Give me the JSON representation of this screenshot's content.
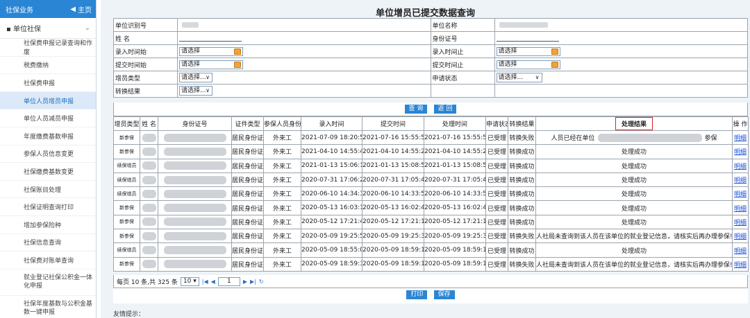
{
  "sidebar": {
    "header": "社保业务",
    "home": "主页",
    "group": "单位社保",
    "items": [
      {
        "label": "社保费申报记录查询和作废",
        "active": false
      },
      {
        "label": "税费缴纳",
        "active": false
      },
      {
        "label": "社保费申报",
        "active": false
      },
      {
        "label": "单位人员增员申报",
        "active": true
      },
      {
        "label": "单位人员减员申报",
        "active": false
      },
      {
        "label": "年度缴费基数申报",
        "active": false
      },
      {
        "label": "参保人员信息变更",
        "active": false
      },
      {
        "label": "社保缴费基数变更",
        "active": false
      },
      {
        "label": "社保账目处理",
        "active": false
      },
      {
        "label": "社保证明查询打印",
        "active": false
      },
      {
        "label": "增加参保险种",
        "active": false
      },
      {
        "label": "社保信息查询",
        "active": false
      },
      {
        "label": "社保费对账单查询",
        "active": false
      },
      {
        "label": "就业登记社保公积金一体化申报",
        "active": false
      },
      {
        "label": "社保年度基数与公积金基数一键申报",
        "active": false
      }
    ]
  },
  "page": {
    "title": "单位增员已提交数据查询"
  },
  "form": {
    "unit_id_label": "单位识别号",
    "unit_name_label": "单位名称",
    "name_label": "姓 名",
    "id_label": "身份证号",
    "entry_start_label": "录入时间始",
    "entry_end_label": "录入时间止",
    "submit_start_label": "提交时间始",
    "submit_end_label": "提交时间止",
    "type_label": "增员类型",
    "status_label": "申请状态",
    "result_label": "转换结果",
    "date_placeholder": "请选择",
    "select_placeholder": "请选择..."
  },
  "buttons": {
    "query": "查 询",
    "back": "返 回",
    "print": "打印",
    "save": "保存"
  },
  "table": {
    "headers": [
      "增员类型",
      "姓 名",
      "身份证号",
      "证件类型",
      "参保人员身份",
      "录入时间",
      "提交时间",
      "处理时间",
      "申请状态",
      "转换结果",
      "处理结果",
      "操 作"
    ],
    "rows": [
      {
        "type": "新参保",
        "idtype": "居民身份证",
        "identity": "外来工",
        "entry": "2021-07-09 18:20:57",
        "submit": "2021-07-16 15:55:51",
        "process": "2021-07-16 15:55:52",
        "status": "已受理",
        "convert": "转换失败",
        "result_a": "人员已经在单位",
        "result_b": "参保",
        "op": "明细"
      },
      {
        "type": "新参保",
        "idtype": "居民身份证",
        "identity": "外来工",
        "entry": "2021-04-10 14:55:46",
        "submit": "2021-04-10 14:55:27",
        "process": "2021-04-10 14:55:29",
        "status": "已受理",
        "convert": "转换成功",
        "result": "处理成功",
        "op": "明细"
      },
      {
        "type": "续保增员",
        "idtype": "居民身份证",
        "identity": "外来工",
        "entry": "2021-01-13 15:06:19",
        "submit": "2021-01-13 15:08:52",
        "process": "2021-01-13 15:08:54",
        "status": "已受理",
        "convert": "转换成功",
        "result": "处理成功",
        "op": "明细"
      },
      {
        "type": "续保增员",
        "idtype": "居民身份证",
        "identity": "外来工",
        "entry": "2020-07-31 17:06:21",
        "submit": "2020-07-31 17:05:42",
        "process": "2020-07-31 17:05:44",
        "status": "已受理",
        "convert": "转换成功",
        "result": "处理成功",
        "op": "明细"
      },
      {
        "type": "续保增员",
        "idtype": "居民身份证",
        "identity": "外来工",
        "entry": "2020-06-10 14:34:34",
        "submit": "2020-06-10 14:33:54",
        "process": "2020-06-10 14:33:55",
        "status": "已受理",
        "convert": "转换成功",
        "result": "处理成功",
        "op": "明细"
      },
      {
        "type": "新参保",
        "idtype": "居民身份证",
        "identity": "外来工",
        "entry": "2020-05-13 16:03:16",
        "submit": "2020-05-13 16:02:47",
        "process": "2020-05-13 16:02:49",
        "status": "已受理",
        "convert": "转换成功",
        "result": "处理成功",
        "op": "明细"
      },
      {
        "type": "新参保",
        "idtype": "居民身份证",
        "identity": "外来工",
        "entry": "2020-05-12 17:21:44",
        "submit": "2020-05-12 17:21:17",
        "process": "2020-05-12 17:21:19",
        "status": "已受理",
        "convert": "转换成功",
        "result": "处理成功",
        "op": "明细"
      },
      {
        "type": "新参保",
        "idtype": "居民身份证",
        "identity": "外来工",
        "entry": "2020-05-09 19:25:58",
        "submit": "2020-05-09 19:25:31",
        "process": "2020-05-09 19:25:32",
        "status": "已受理",
        "convert": "转换失败",
        "result": "人社局未查询到该人员在该单位的就业登记信息，请核实后再办理参保!",
        "op": "明细"
      },
      {
        "type": "续保增员",
        "idtype": "居民身份证",
        "identity": "外来工",
        "entry": "2020-05-09 18:55:03",
        "submit": "2020-05-09 18:59:14",
        "process": "2020-05-09 18:59:15",
        "status": "已受理",
        "convert": "转换成功",
        "result": "处理成功",
        "op": "明细"
      },
      {
        "type": "新参保",
        "idtype": "居民身份证",
        "identity": "外来工",
        "entry": "2020-05-09 18:59:38",
        "submit": "2020-05-09 18:59:13",
        "process": "2020-05-09 18:59:14",
        "status": "已受理",
        "convert": "转换失败",
        "result": "人社局未查询到该人员在该单位的就业登记信息，请核实后再办理参保!",
        "op": "明细"
      }
    ]
  },
  "pager": {
    "prefix": "每页 10 条,共 325 条",
    "page_size": "10",
    "page": "1"
  },
  "tips": {
    "label": "友情提示："
  },
  "colors": {
    "accent": "#2a85d4",
    "highlight_border": "#e02020",
    "active_menu_bg": "#dbe9f8"
  }
}
